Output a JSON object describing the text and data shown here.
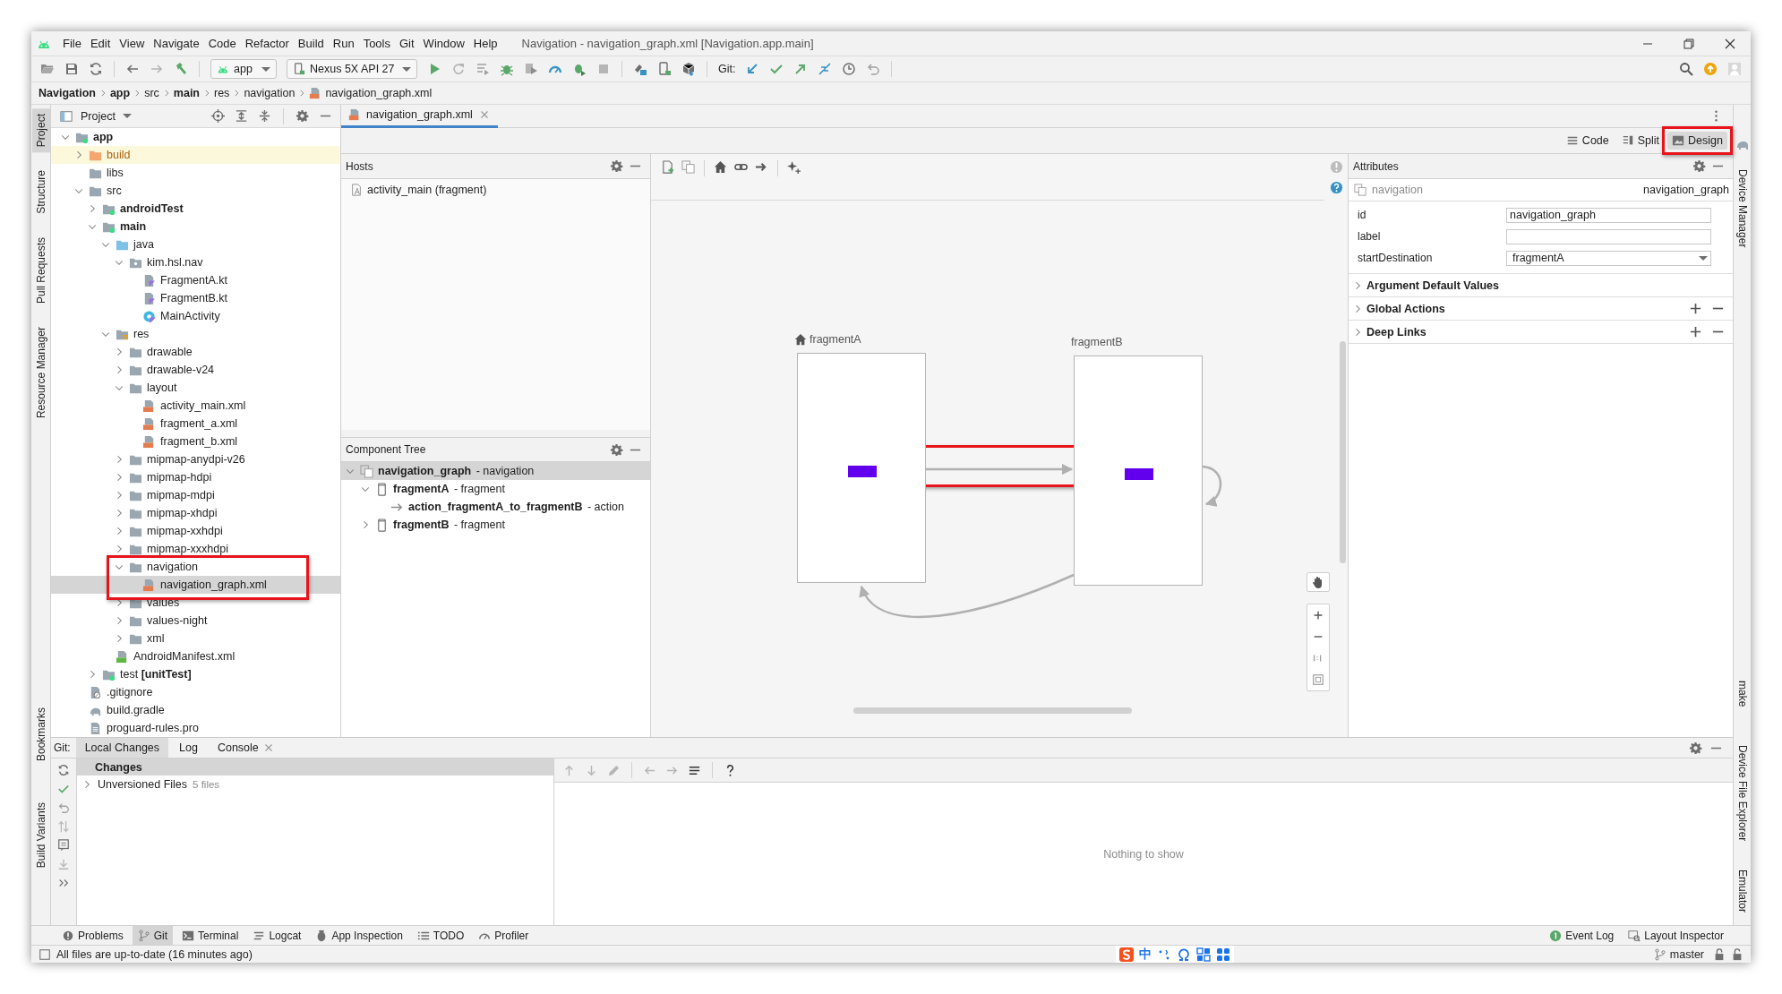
{
  "window": {
    "title": "Navigation - navigation_graph.xml [Navigation.app.main]"
  },
  "menu": [
    "File",
    "Edit",
    "View",
    "Navigate",
    "Code",
    "Refactor",
    "Build",
    "Run",
    "Tools",
    "Git",
    "Window",
    "Help"
  ],
  "toolbar": {
    "run_config": "app",
    "device": "Nexus 5X API 27",
    "git_label": "Git:"
  },
  "breadcrumb": [
    {
      "label": "Navigation",
      "bold": true
    },
    {
      "label": "app",
      "bold": true
    },
    {
      "label": "src",
      "bold": false
    },
    {
      "label": "main",
      "bold": true
    },
    {
      "label": "res",
      "bold": false
    },
    {
      "label": "navigation",
      "bold": false
    },
    {
      "label": "navigation_graph.xml",
      "bold": false,
      "kind": "xml"
    }
  ],
  "left_strip": {
    "top": [
      {
        "label": "Project",
        "selected": true
      },
      {
        "label": "Structure",
        "selected": false
      },
      {
        "label": "Pull Requests",
        "selected": false
      },
      {
        "label": "Resource Manager",
        "selected": false
      }
    ],
    "bottom": [
      {
        "label": "Bookmarks",
        "selected": false
      },
      {
        "label": "Build Variants",
        "selected": false
      }
    ]
  },
  "right_strip": {
    "top": [
      {
        "label": "Device Manager",
        "selected": false
      }
    ],
    "bottom": [
      {
        "label": "make",
        "selected": false
      },
      {
        "label": "Device File Explorer",
        "selected": false
      },
      {
        "label": "Emulator",
        "selected": false
      }
    ]
  },
  "project": {
    "title": "Project",
    "tree": [
      {
        "label": "app",
        "kind": "module",
        "bold": true,
        "expanded": true,
        "selected": false,
        "children": [
          {
            "label": "build",
            "kind": "build",
            "expanded": false,
            "selected": false
          },
          {
            "label": "libs",
            "kind": "folder",
            "selected": false
          },
          {
            "label": "src",
            "kind": "folder",
            "expanded": true,
            "selected": false,
            "children": [
              {
                "label": "androidTest",
                "kind": "module",
                "bold": true,
                "expanded": false,
                "selected": false
              },
              {
                "label": "main",
                "kind": "module",
                "bold": true,
                "expanded": true,
                "selected": false,
                "children": [
                  {
                    "label": "java",
                    "kind": "java",
                    "expanded": true,
                    "selected": false,
                    "children": [
                      {
                        "label": "kim.hsl.nav",
                        "kind": "package",
                        "expanded": true,
                        "selected": false,
                        "children": [
                          {
                            "label": "FragmentA.kt",
                            "kind": "kotlin",
                            "selected": false
                          },
                          {
                            "label": "FragmentB.kt",
                            "kind": "kotlin",
                            "selected": false
                          },
                          {
                            "label": "MainActivity",
                            "kind": "activity",
                            "selected": false
                          }
                        ]
                      }
                    ]
                  },
                  {
                    "label": "res",
                    "kind": "res",
                    "expanded": true,
                    "selected": false,
                    "children": [
                      {
                        "label": "drawable",
                        "kind": "folder",
                        "expanded": false,
                        "selected": false
                      },
                      {
                        "label": "drawable-v24",
                        "kind": "folder",
                        "expanded": false,
                        "selected": false
                      },
                      {
                        "label": "layout",
                        "kind": "folder",
                        "expanded": true,
                        "selected": false,
                        "children": [
                          {
                            "label": "activity_main.xml",
                            "kind": "xml",
                            "selected": false
                          },
                          {
                            "label": "fragment_a.xml",
                            "kind": "xml",
                            "selected": false
                          },
                          {
                            "label": "fragment_b.xml",
                            "kind": "xml",
                            "selected": false
                          }
                        ]
                      },
                      {
                        "label": "mipmap-anydpi-v26",
                        "kind": "folder",
                        "expanded": false,
                        "selected": false
                      },
                      {
                        "label": "mipmap-hdpi",
                        "kind": "folder",
                        "expanded": false,
                        "selected": false
                      },
                      {
                        "label": "mipmap-mdpi",
                        "kind": "folder",
                        "expanded": false,
                        "selected": false
                      },
                      {
                        "label": "mipmap-xhdpi",
                        "kind": "folder",
                        "expanded": false,
                        "selected": false
                      },
                      {
                        "label": "mipmap-xxhdpi",
                        "kind": "folder",
                        "expanded": false,
                        "selected": false
                      },
                      {
                        "label": "mipmap-xxxhdpi",
                        "kind": "folder",
                        "expanded": false,
                        "selected": false
                      },
                      {
                        "label": "navigation",
                        "kind": "folder",
                        "expanded": true,
                        "selected": false,
                        "highlighted": true,
                        "children": [
                          {
                            "label": "navigation_graph.xml",
                            "kind": "xml",
                            "selected": true,
                            "highlighted": true
                          }
                        ]
                      },
                      {
                        "label": "values",
                        "kind": "folder",
                        "expanded": false,
                        "selected": false
                      },
                      {
                        "label": "values-night",
                        "kind": "folder",
                        "expanded": false,
                        "selected": false
                      },
                      {
                        "label": "xml",
                        "kind": "folder",
                        "expanded": false,
                        "selected": false
                      }
                    ]
                  },
                  {
                    "label": "AndroidManifest.xml",
                    "kind": "manifest",
                    "selected": false
                  }
                ]
              },
              {
                "label": "test **[unitTest]**",
                "kind": "module",
                "expanded": false,
                "selected": false
              }
            ]
          },
          {
            "label": ".gitignore",
            "kind": "gitignore",
            "selected": false
          },
          {
            "label": "build.gradle",
            "kind": "gradle",
            "selected": false
          },
          {
            "label": "proguard-rules.pro",
            "kind": "text",
            "selected": false
          }
        ]
      }
    ]
  },
  "editor": {
    "tabs": [
      {
        "label": "navigation_graph.xml",
        "selected": true
      }
    ],
    "view_modes": [
      {
        "label": "Code",
        "selected": false,
        "highlighted": false
      },
      {
        "label": "Split",
        "selected": false,
        "highlighted": false
      },
      {
        "label": "Design",
        "selected": true,
        "highlighted": true
      }
    ]
  },
  "hosts": {
    "title": "Hosts",
    "items": [
      "activity_main (fragment)"
    ]
  },
  "component_tree": {
    "title": "Component Tree",
    "items": [
      {
        "label": "**navigation_graph** - navigation",
        "kind": "graph",
        "expanded": true,
        "selected": true,
        "children": [
          {
            "label": "**fragmentA** - fragment",
            "kind": "fragment",
            "expanded": true,
            "selected": false,
            "children": [
              {
                "label": "**action_fragmentA_to_fragmentB** - action",
                "kind": "action",
                "selected": false
              }
            ]
          },
          {
            "label": "**fragmentB** - fragment",
            "kind": "fragment",
            "expanded": false,
            "selected": false
          }
        ]
      }
    ]
  },
  "graph": {
    "destinations": [
      {
        "label": "fragmentA",
        "start": true
      },
      {
        "label": "fragmentB",
        "start": false
      }
    ],
    "actions": [
      {
        "kind": "forward",
        "highlighted": true
      },
      {
        "kind": "return"
      },
      {
        "kind": "self"
      }
    ]
  },
  "attributes": {
    "title": "Attributes",
    "element_type": "navigation",
    "element_id": "navigation_graph",
    "fields": [
      {
        "label": "id",
        "kind": "text",
        "value": "navigation_graph"
      },
      {
        "label": "label",
        "kind": "text"
      },
      {
        "label": "startDestination",
        "kind": "dropdown",
        "value": "fragmentA"
      }
    ],
    "sections": [
      {
        "label": "Argument Default Values",
        "expanded": false,
        "addable": false
      },
      {
        "label": "Global Actions",
        "expanded": false,
        "addable": true
      },
      {
        "label": "Deep Links",
        "expanded": false,
        "addable": true
      }
    ]
  },
  "git_panel": {
    "prefix": "Git:",
    "tabs": [
      {
        "label": "Local Changes",
        "selected": true,
        "closable": false
      },
      {
        "label": "Log",
        "selected": false,
        "closable": false
      },
      {
        "label": "Console",
        "selected": false,
        "closable": true
      }
    ],
    "changes": {
      "header": "Changes",
      "groups": [
        {
          "label": "Unversioned Files",
          "count": "5 files",
          "expanded": false
        }
      ]
    },
    "empty_message": "Nothing to show"
  },
  "tool_strip": {
    "left": [
      {
        "label": "Problems",
        "kind": "problems",
        "selected": false
      },
      {
        "label": "Git",
        "kind": "git",
        "selected": true
      },
      {
        "label": "Terminal",
        "kind": "terminal",
        "selected": false
      },
      {
        "label": "Logcat",
        "kind": "logcat",
        "selected": false
      },
      {
        "label": "App Inspection",
        "kind": "inspection",
        "selected": false
      },
      {
        "label": "TODO",
        "kind": "todo",
        "selected": false
      },
      {
        "label": "Profiler",
        "kind": "profiler",
        "selected": false
      }
    ],
    "right": [
      {
        "label": "Event Log",
        "kind": "eventlog",
        "selected": false
      },
      {
        "label": "Layout Inspector",
        "kind": "layout",
        "selected": false
      }
    ]
  },
  "status_bar": {
    "message": "All files are up-to-date (16 minutes ago)",
    "ime_mode": "中",
    "branch": "master"
  }
}
